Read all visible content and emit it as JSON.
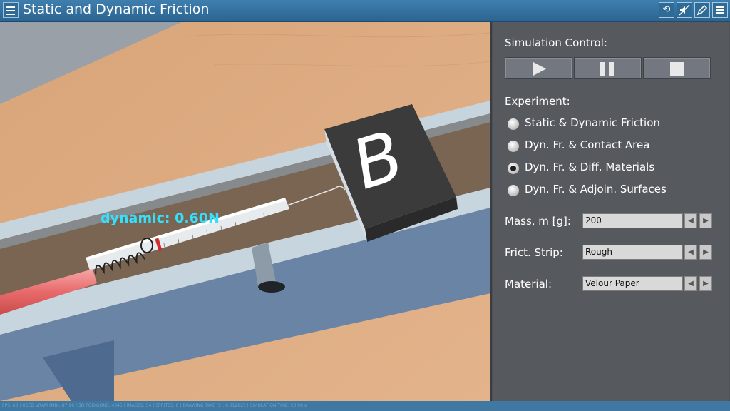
{
  "app": {
    "title": "Static and Dynamic Friction"
  },
  "toolbar": {
    "menu_icon": "hamburger-icon",
    "buttons": [
      {
        "name": "reset-icon",
        "glyph": "⟲"
      },
      {
        "name": "mute-icon",
        "glyph": "🔇"
      },
      {
        "name": "edit-icon",
        "glyph": "✎"
      },
      {
        "name": "list-icon",
        "glyph": "☰"
      }
    ]
  },
  "scene": {
    "block_letter": "B",
    "dynamic_readout": "dynamic: 0.60N",
    "readout_color": "#33e1ff"
  },
  "panel": {
    "simulation_control_label": "Simulation Control:",
    "controls": [
      "play-icon",
      "pause-icon",
      "stop-icon"
    ],
    "experiment_label": "Experiment:",
    "experiments": [
      {
        "label": "Static & Dynamic Friction",
        "selected": false
      },
      {
        "label": "Dyn. Fr. & Contact Area",
        "selected": false
      },
      {
        "label": "Dyn. Fr. & Diff. Materials",
        "selected": true
      },
      {
        "label": "Dyn. Fr. & Adjoin. Surfaces",
        "selected": false
      }
    ],
    "mass_label": "Mass, m [g]:",
    "mass_value": "200",
    "strip_label": "Frict. Strip:",
    "strip_value": "Rough",
    "material_label": "Material:",
    "material_value": "Velour Paper"
  },
  "status": {
    "text": "FPS: 60 | USED VRAM (MB): 87.96 | 3D POLYGONS: 4345 | IMAGES: 54 | SPRITES: 8 | DRAWING TIME [S]: 0.012825 | SIMULATION TIME: 50.98 s"
  }
}
